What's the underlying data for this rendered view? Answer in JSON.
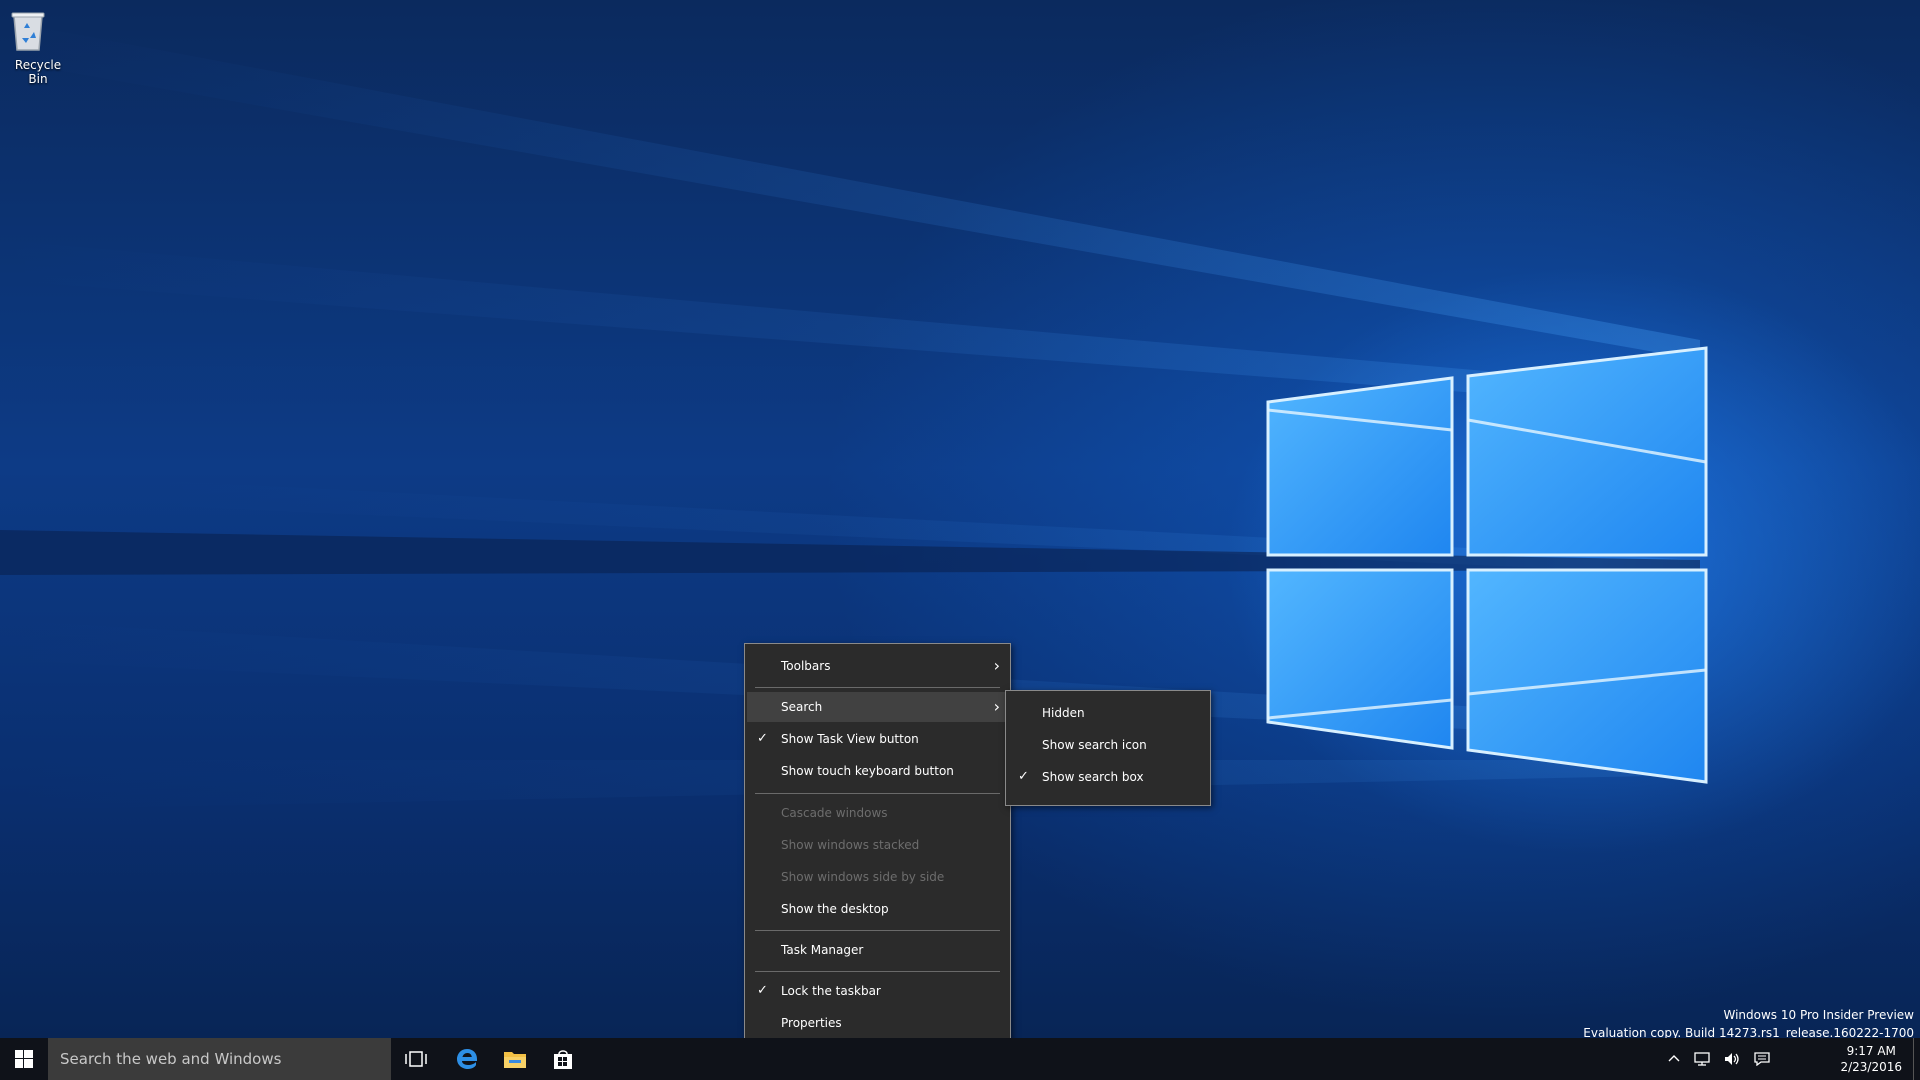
{
  "desktop": {
    "icons": [
      {
        "label": "Recycle Bin",
        "icon": "recycle-bin-icon"
      }
    ],
    "watermark": {
      "line1": "Windows 10 Pro Insider Preview",
      "line2": "Evaluation copy. Build 14273.rs1_release.160222-1700"
    }
  },
  "context_menu": {
    "items": [
      {
        "label": "Toolbars",
        "submenu": true
      },
      {
        "label": "Search",
        "submenu": true,
        "highlighted": true
      },
      {
        "label": "Show Task View button",
        "checked": true
      },
      {
        "label": "Show touch keyboard button"
      },
      {
        "label": "Cascade windows",
        "disabled": true
      },
      {
        "label": "Show windows stacked",
        "disabled": true
      },
      {
        "label": "Show windows side by side",
        "disabled": true
      },
      {
        "label": "Show the desktop"
      },
      {
        "label": "Task Manager"
      },
      {
        "label": "Lock the taskbar",
        "checked": true
      },
      {
        "label": "Properties"
      }
    ],
    "check_glyph": "✓",
    "arrow_glyph": "›"
  },
  "search_submenu": {
    "items": [
      {
        "label": "Hidden"
      },
      {
        "label": "Show search icon"
      },
      {
        "label": "Show search box",
        "checked": true
      }
    ]
  },
  "taskbar": {
    "search_placeholder": "Search the web and Windows",
    "pinned": [
      "task-view-icon",
      "edge-icon",
      "file-explorer-icon",
      "store-icon"
    ],
    "tray_icons": [
      "chevron-up-icon",
      "network-icon",
      "volume-icon",
      "action-center-icon"
    ],
    "time": "9:17 AM",
    "date": "2/23/2016"
  },
  "colors": {
    "menu_bg": "#2b2b2b",
    "menu_hover": "#414141",
    "taskbar_bg": "#0f1219",
    "search_bg": "#3b3b3b",
    "desktop_light": "#2f8cff"
  }
}
